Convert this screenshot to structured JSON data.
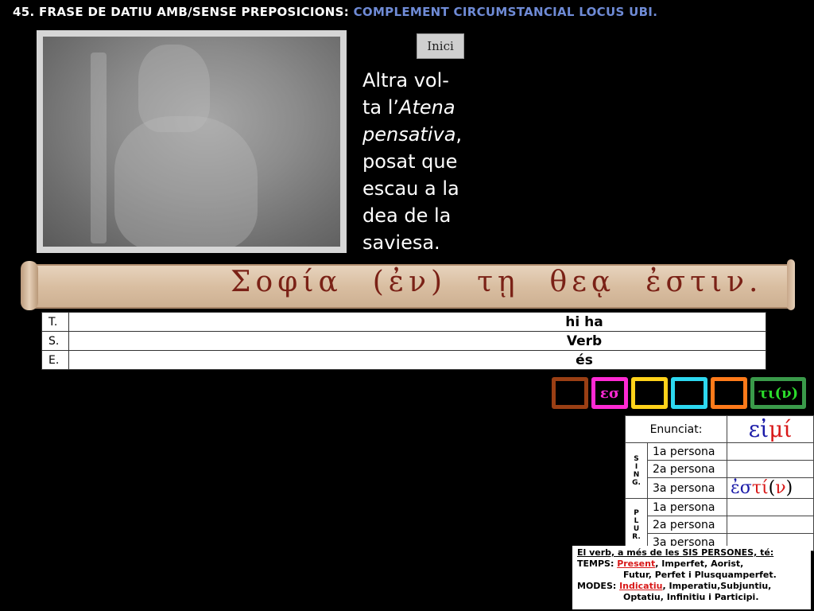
{
  "title": {
    "prefix": "45. FRASE DE DATIU AMB/SENSE PREPOSICIONS: ",
    "accent": "COMPLEMENT CIRCUMSTANCIAL LOCUS UBI."
  },
  "nav": {
    "inici_label": "Inici"
  },
  "caption": {
    "line1": "Altra vol-",
    "line2_pre": "ta l’",
    "line2_it": "Atena",
    "line3_it": "pensativa",
    "line3_post": ",",
    "line4": "posat que",
    "line5": "escau a la",
    "line6": "dea de la",
    "line7": "saviesa."
  },
  "greek_phrase": {
    "w1": "Σοφία",
    "w2": "(ἐν)",
    "w3": "τῃ",
    "w4": "θεᾳ",
    "w5": "ἐστιν."
  },
  "analysis": {
    "rows": [
      {
        "label": "T.",
        "value": "hi ha"
      },
      {
        "label": "S.",
        "value": "Verb"
      },
      {
        "label": "E.",
        "value": "és"
      }
    ]
  },
  "boxes": {
    "b2": "εσ",
    "b6": "τι(ν)"
  },
  "conjugation": {
    "enunciat_label": "Enunciat:",
    "enunciat_pre": "εἰ",
    "enunciat_red": "μί",
    "sing_label": "S I N G.",
    "plur_label": "P L U R.",
    "persons": [
      "1a persona",
      "2a persona",
      "3a persona"
    ],
    "form_3sg_blue": "ἐσ",
    "form_3sg_red": "τί",
    "form_3sg_paren_open": "(",
    "form_3sg_nu": "ν",
    "form_3sg_paren_close": ")"
  },
  "notes": {
    "line1": "El verb, a més de les SIS PERSONES, té:",
    "temps_label": "TEMPS: ",
    "temps_highlight": "Present",
    "temps_rest": ", Imperfet, Aorist,",
    "temps_line2": "Futur, Perfet i Plusquamperfet.",
    "modes_label": "MODES: ",
    "modes_highlight": "Indicatiu",
    "modes_rest": ", Imperatiu,Subjuntiu,",
    "modes_line2": "Optatiu, Infinitiu i Participi."
  },
  "colors": {
    "title_accent": "#6f8bd6",
    "greek_text": "#7a2116",
    "value_t": "#1a1a9c",
    "value_s": "#ff3fa8",
    "value_e": "#0a6b0a"
  }
}
